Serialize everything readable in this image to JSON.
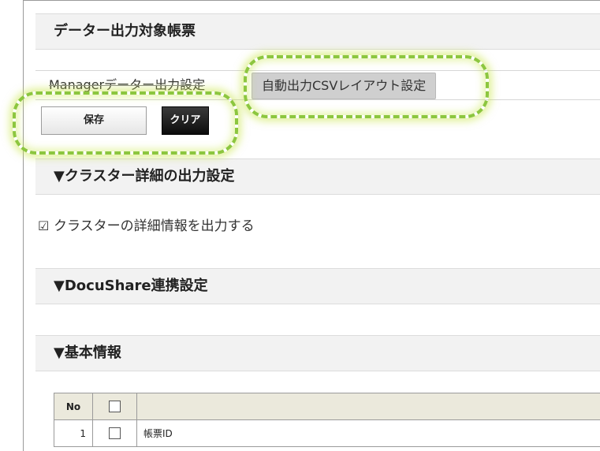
{
  "sections": {
    "output_target": "データー出力対象帳票",
    "cluster_detail": "▼クラスター詳細の出力設定",
    "docushare": "▼DocuShare連携設定",
    "basic_info": "▼基本情報"
  },
  "tabs": {
    "manager_output": "Managerデーター出力設定",
    "auto_csv": "自動出力CSVレイアウト設定"
  },
  "buttons": {
    "save": "保存",
    "clear": "クリア"
  },
  "cluster_option": {
    "checked": true,
    "label": "クラスターの詳細情報を出力する"
  },
  "table": {
    "headers": {
      "no": "No",
      "name": ""
    },
    "rows": [
      {
        "no": "1",
        "name": "帳票ID"
      }
    ]
  },
  "highlight_color": "#8cc63f"
}
